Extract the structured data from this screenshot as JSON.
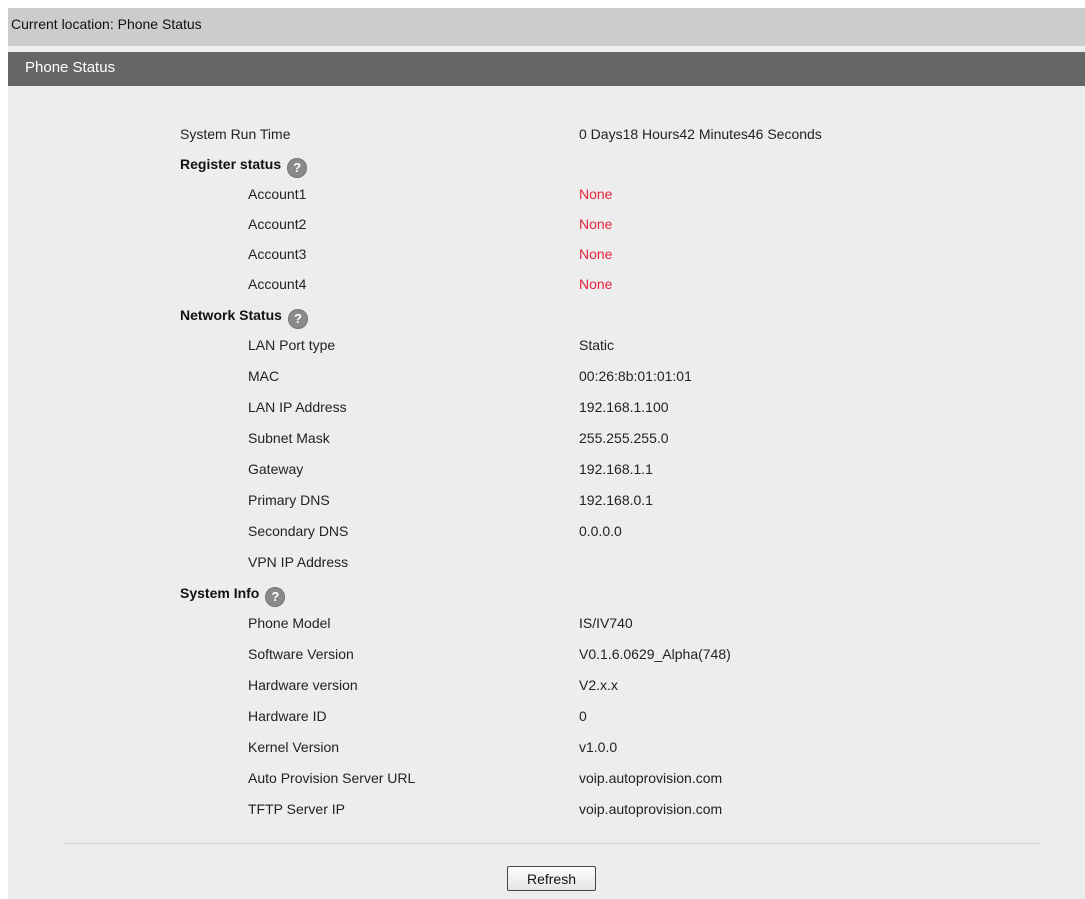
{
  "location": {
    "text": "Current location: Phone Status"
  },
  "header": {
    "title": "Phone Status"
  },
  "run_time": {
    "label": "System Run Time",
    "value": "0 Days18 Hours42 Minutes46 Seconds"
  },
  "register": {
    "title": "Register status",
    "help_icon": "question-icon",
    "rows": [
      {
        "label": "Account1",
        "value": "None"
      },
      {
        "label": "Account2",
        "value": "None"
      },
      {
        "label": "Account3",
        "value": "None"
      },
      {
        "label": "Account4",
        "value": "None"
      }
    ],
    "value_color": "#e3243b"
  },
  "network": {
    "title": "Network Status",
    "help_icon": "question-icon",
    "rows": [
      {
        "label": "LAN Port type",
        "value": "Static"
      },
      {
        "label": "MAC",
        "value": "00:26:8b:01:01:01"
      },
      {
        "label": "LAN IP Address",
        "value": "192.168.1.100"
      },
      {
        "label": "Subnet Mask",
        "value": "255.255.255.0"
      },
      {
        "label": "Gateway",
        "value": "192.168.1.1"
      },
      {
        "label": "Primary DNS",
        "value": "192.168.0.1"
      },
      {
        "label": "Secondary DNS",
        "value": "0.0.0.0"
      },
      {
        "label": "VPN IP Address",
        "value": ""
      }
    ]
  },
  "system": {
    "title": "System Info",
    "help_icon": "question-icon",
    "rows": [
      {
        "label": "Phone Model",
        "value": "IS/IV740"
      },
      {
        "label": "Software Version",
        "value": "V0.1.6.0629_Alpha(748)"
      },
      {
        "label": "Hardware version",
        "value": "V2.x.x"
      },
      {
        "label": "Hardware ID",
        "value": "0"
      },
      {
        "label": "Kernel Version",
        "value": "v1.0.0"
      },
      {
        "label": "Auto Provision Server URL",
        "value": "voip.autoprovision.com"
      },
      {
        "label": "TFTP Server IP",
        "value": "voip.autoprovision.com"
      }
    ]
  },
  "actions": {
    "refresh_label": "Refresh"
  },
  "colors": {
    "location_bar": "#cccccc",
    "header_bar": "#666666",
    "content_bg": "#ededed",
    "error_value": "#e3243b"
  }
}
